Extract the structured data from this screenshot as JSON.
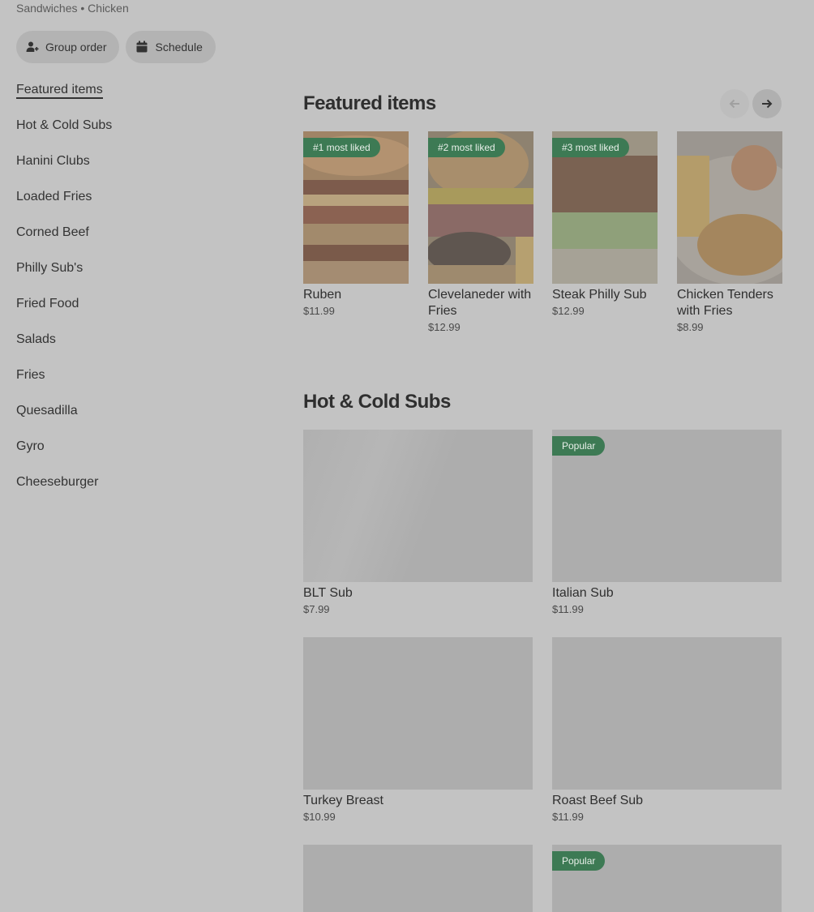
{
  "breadcrumb": "Sandwiches • Chicken",
  "actions": {
    "group_order": "Group order",
    "schedule": "Schedule"
  },
  "sidebar": {
    "items": [
      {
        "label": "Featured items"
      },
      {
        "label": "Hot & Cold Subs"
      },
      {
        "label": "Hanini Clubs"
      },
      {
        "label": "Loaded Fries"
      },
      {
        "label": "Corned Beef"
      },
      {
        "label": "Philly Sub's"
      },
      {
        "label": "Fried Food"
      },
      {
        "label": "Salads"
      },
      {
        "label": "Fries"
      },
      {
        "label": "Quesadilla"
      },
      {
        "label": "Gyro"
      },
      {
        "label": "Cheeseburger"
      }
    ]
  },
  "featured": {
    "title": "Featured items",
    "items": [
      {
        "name": "Ruben",
        "price": "$11.99",
        "badge": "#1 most liked"
      },
      {
        "name": "Clevelaneder with Fries",
        "price": "$12.99",
        "badge": "#2 most liked"
      },
      {
        "name": "Steak Philly Sub",
        "price": "$12.99",
        "badge": "#3 most liked"
      },
      {
        "name": "Chicken Tenders with Fries",
        "price": "$8.99",
        "badge": ""
      }
    ]
  },
  "subs": {
    "title": "Hot & Cold Subs",
    "items": [
      {
        "name": "BLT Sub",
        "price": "$7.99",
        "badge": ""
      },
      {
        "name": "Italian Sub",
        "price": "$11.99",
        "badge": "Popular"
      },
      {
        "name": "Turkey Breast",
        "price": "$10.99",
        "badge": ""
      },
      {
        "name": "Roast Beef Sub",
        "price": "$11.99",
        "badge": ""
      },
      {
        "name": "",
        "price": "",
        "badge": ""
      },
      {
        "name": "",
        "price": "",
        "badge": "Popular"
      }
    ]
  },
  "colors": {
    "overlay_bg": "#c3c3c3",
    "badge_green": "#3d7a54"
  }
}
